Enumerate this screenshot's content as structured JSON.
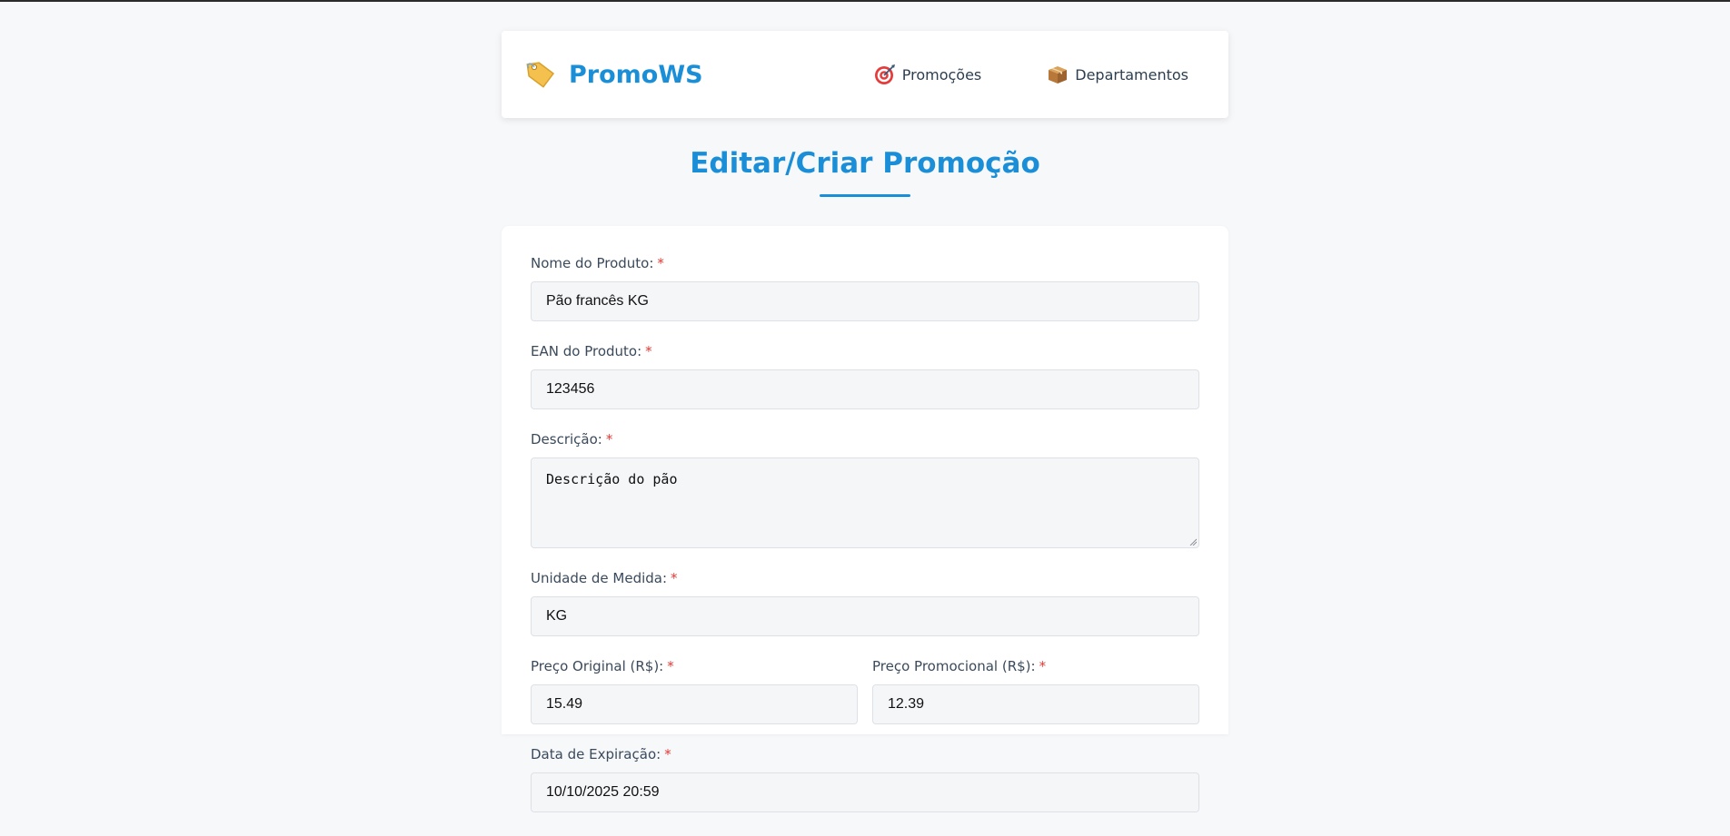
{
  "nav": {
    "brand_icon": "price-tag-icon",
    "brand_name": "PromoWS",
    "links": [
      {
        "icon": "target-icon",
        "label": "Promoções"
      },
      {
        "icon": "package-icon",
        "label": "Departamentos"
      }
    ]
  },
  "page": {
    "title": "Editar/Criar Promoção"
  },
  "form": {
    "required_marker": "*",
    "product_name": {
      "label": "Nome do Produto:",
      "value": "Pão francês KG"
    },
    "ean": {
      "label": "EAN do Produto:",
      "value": "123456"
    },
    "description": {
      "label": "Descrição:",
      "value": "Descrição do pão"
    },
    "unit": {
      "label": "Unidade de Medida:",
      "value": "KG"
    },
    "original_price": {
      "label": "Preço Original (R$):",
      "value": "15.49"
    },
    "promo_price": {
      "label": "Preço Promocional (R$):",
      "value": "12.39"
    },
    "expiration": {
      "label": "Data de Expiração:",
      "value": "10/10/2025 20:59"
    }
  },
  "colors": {
    "accent": "#1a8fd8",
    "required": "#e53935",
    "background": "#f7f8fa"
  }
}
